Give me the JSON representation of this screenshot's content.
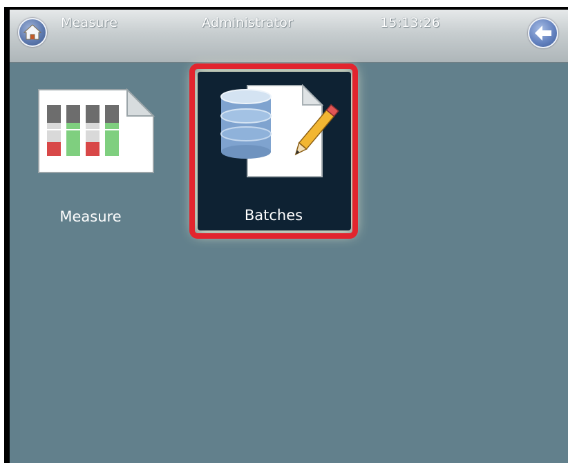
{
  "titlebar": {
    "title": "Measure",
    "user": "Administrator",
    "time": "15:13:26",
    "home_icon": "home-icon",
    "back_icon": "back-arrow-icon"
  },
  "apps": [
    {
      "label": "Measure",
      "icon": "measure-document-icon"
    },
    {
      "label": "Batches",
      "icon": "batches-database-document-icon",
      "selected": true
    }
  ],
  "colors": {
    "screen_bg": "#62808c",
    "highlight": "#e2252e",
    "selected_tile_bg": "#0e2233"
  }
}
